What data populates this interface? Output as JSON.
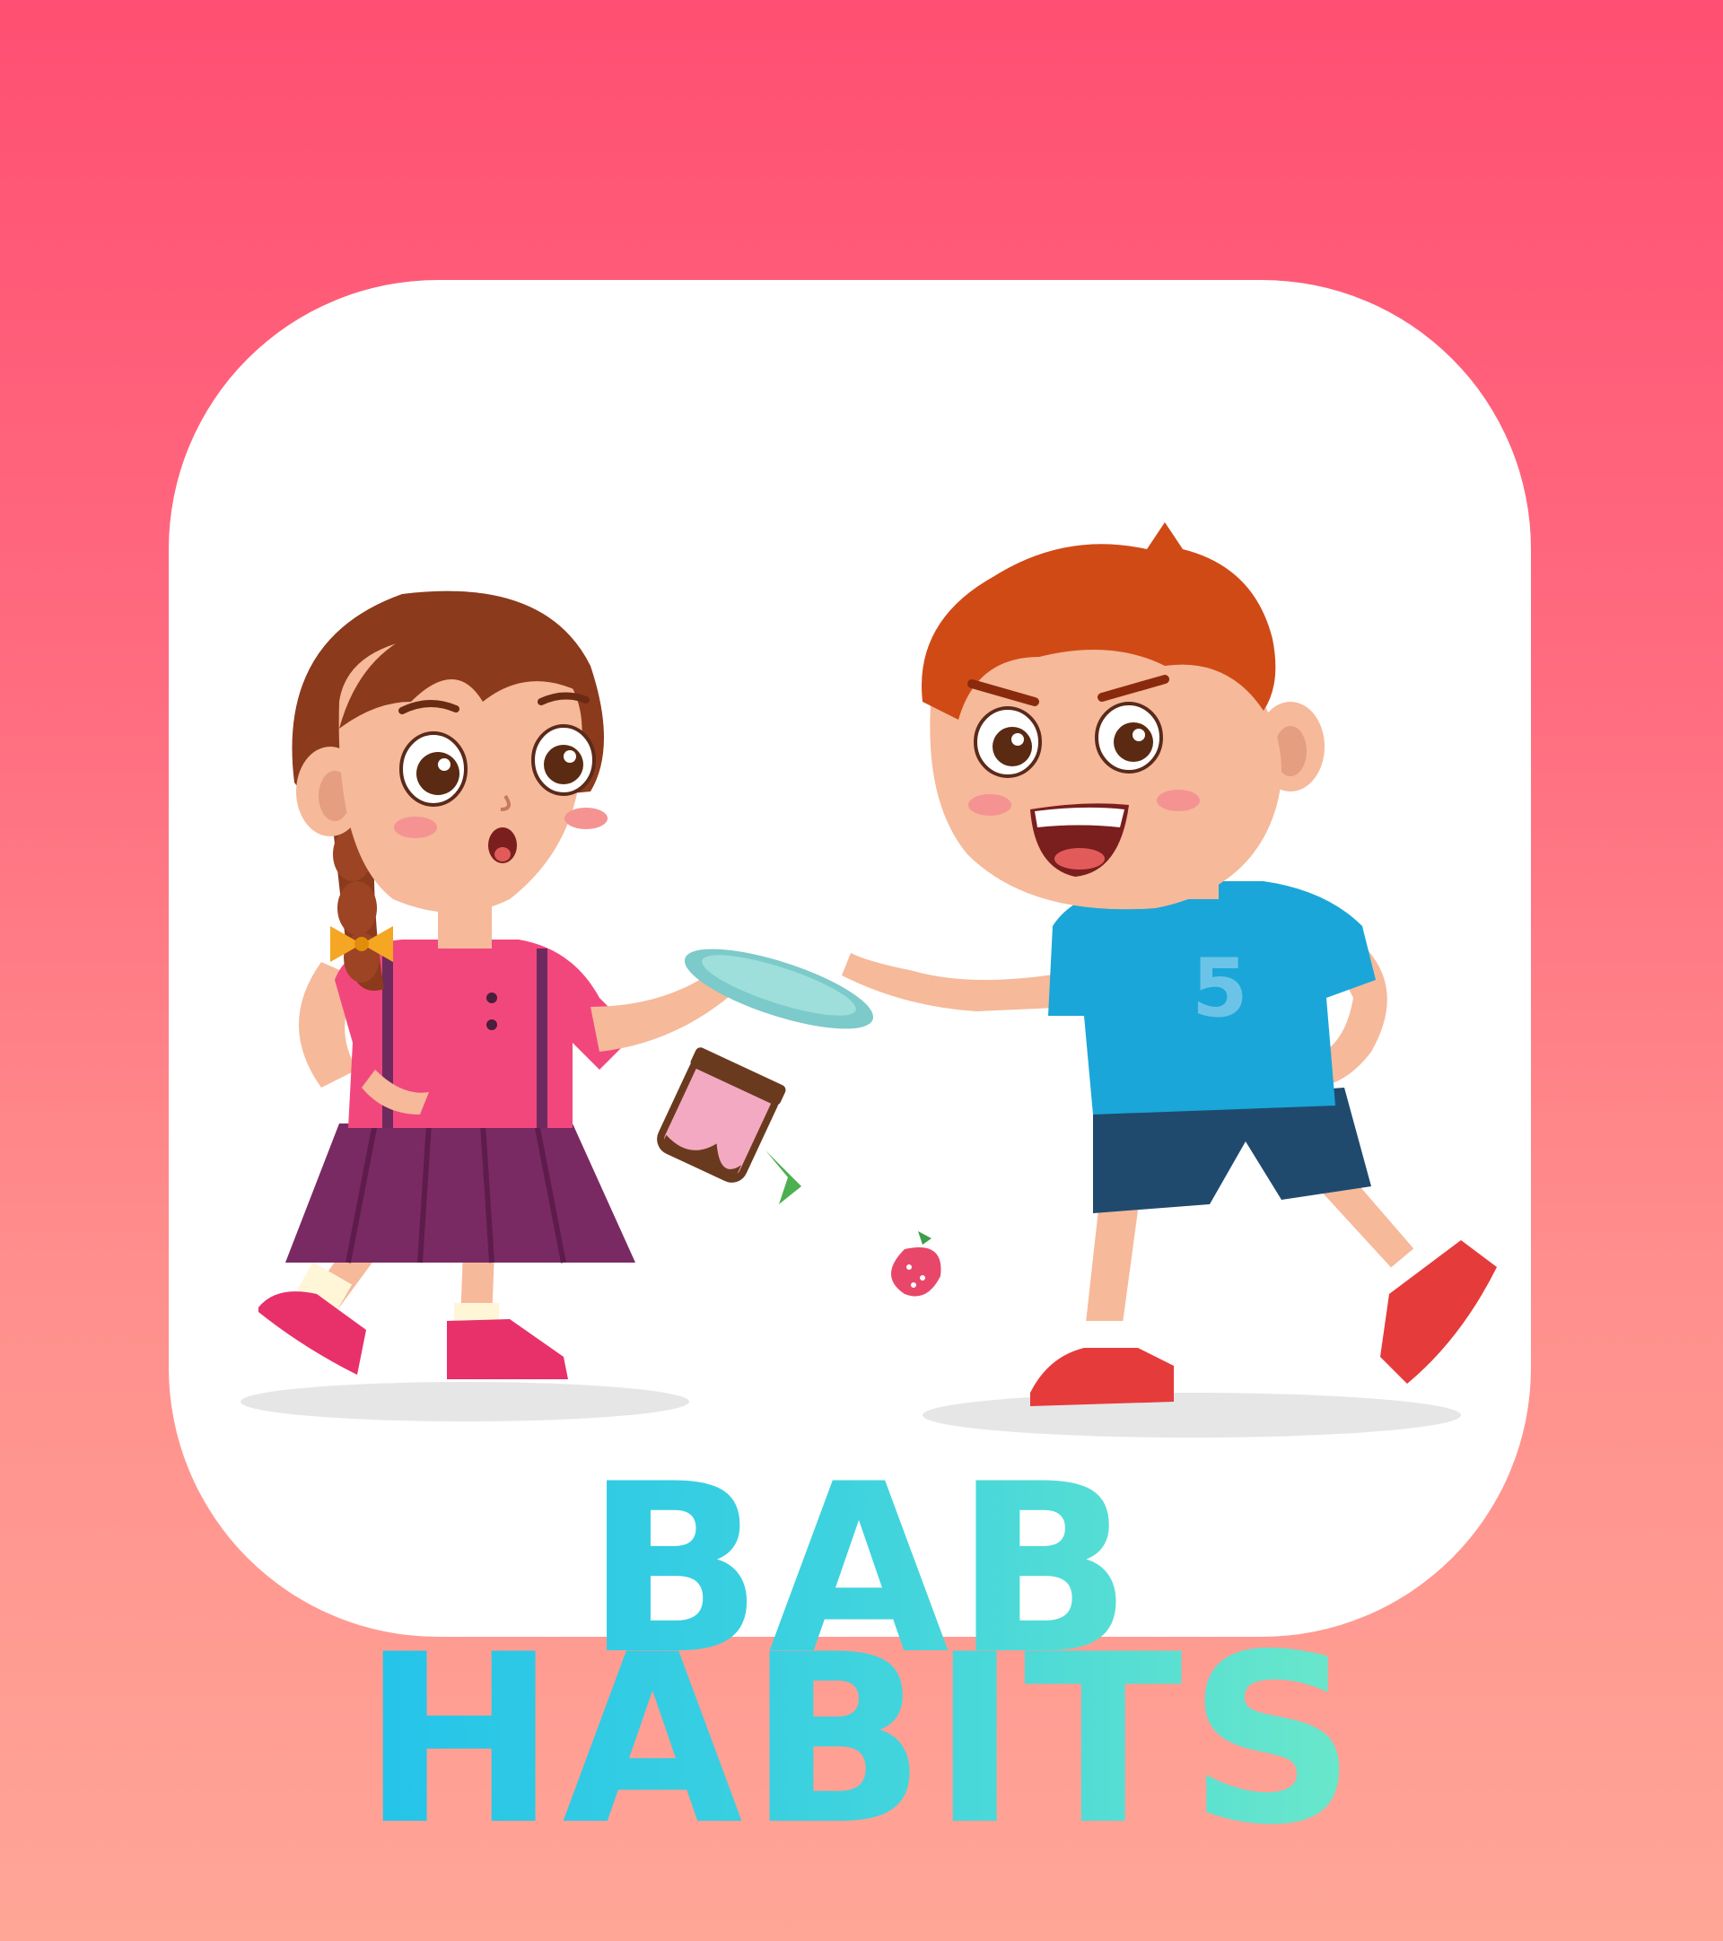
{
  "title": {
    "line1": "BAB",
    "line2": "HABITS"
  },
  "colors": {
    "bg_top": "#FF4F72",
    "bg_bottom": "#FFA697",
    "card": "#FFFFFF",
    "title_gradient_start": "#10B8F2",
    "title_gradient_end": "#8AF7BB"
  },
  "illustration": {
    "shirt_number": "5"
  }
}
